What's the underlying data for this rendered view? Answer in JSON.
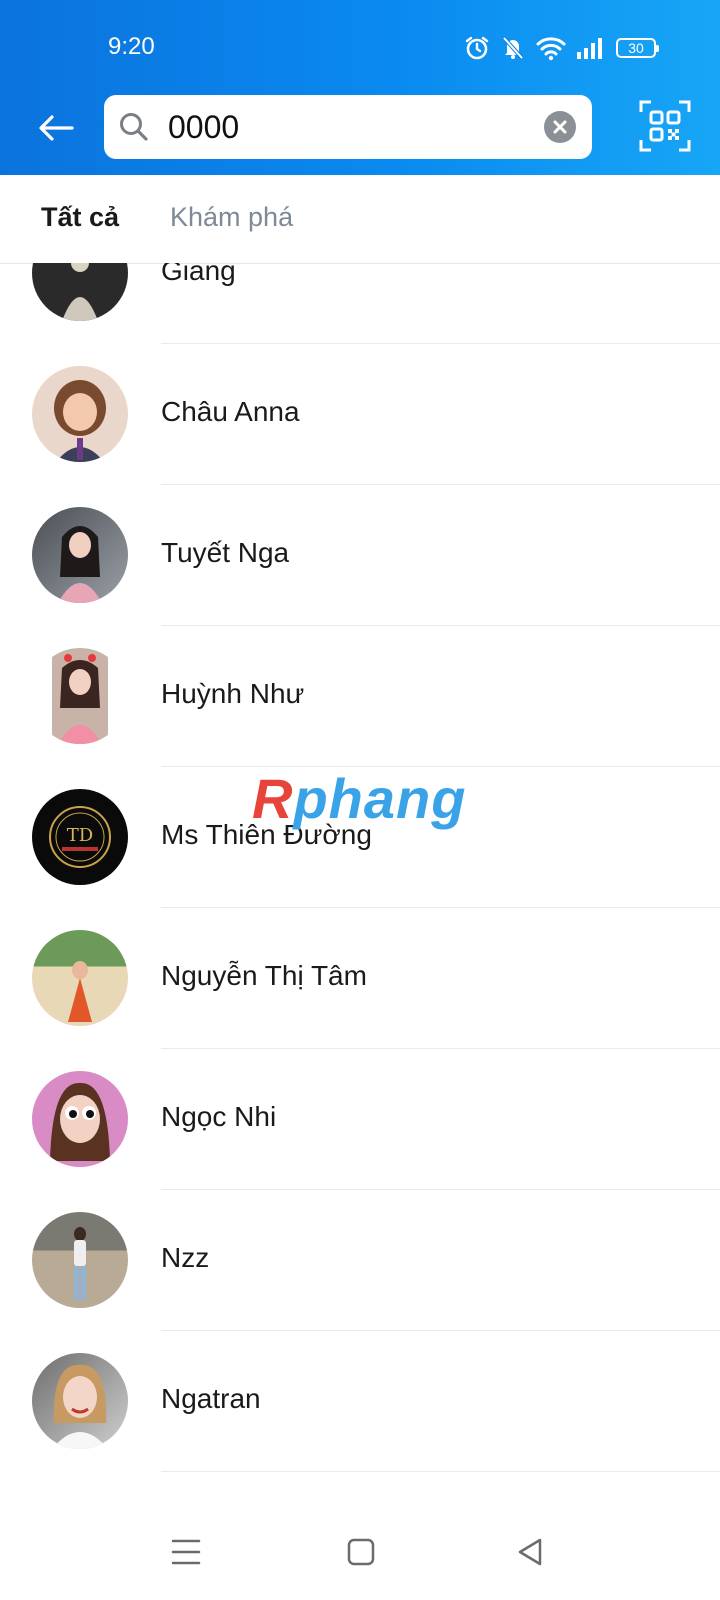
{
  "status": {
    "time": "9:20",
    "battery": "30"
  },
  "search": {
    "value": "0000"
  },
  "tabs": [
    {
      "label": "Tất cả"
    },
    {
      "label": "Khám phá"
    }
  ],
  "contacts": [
    {
      "name": "Giang"
    },
    {
      "name": "Châu Anna"
    },
    {
      "name": "Tuyết Nga"
    },
    {
      "name": "Huỳnh Như"
    },
    {
      "name": "Ms Thiên Đường",
      "avatar_text": "TD"
    },
    {
      "name": "Nguyễn Thị Tâm"
    },
    {
      "name": "Ngọc Nhi"
    },
    {
      "name": "Nzz"
    },
    {
      "name": "Ngatran"
    }
  ],
  "watermark": {
    "first": "R",
    "rest": "phang"
  },
  "colors": {
    "header_start": "#0b73dd",
    "header_end": "#17a6f6",
    "watermark_red": "#e8453a",
    "watermark_blue": "#3aa3e8"
  },
  "icons": [
    "back-arrow-icon",
    "search-icon",
    "clear-icon",
    "qr-code-icon",
    "alarm-icon",
    "bell-off-icon",
    "wifi-icon",
    "signal-icon",
    "battery-icon",
    "menu-icon",
    "home-icon",
    "back-icon"
  ]
}
